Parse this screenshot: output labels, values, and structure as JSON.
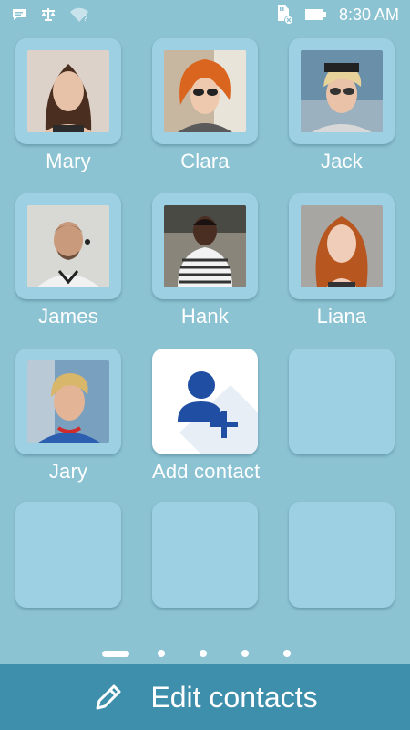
{
  "status_bar": {
    "time": "8:30 AM",
    "icons": [
      "chat-icon",
      "scale-icon",
      "wifi-question-icon",
      "sd-card-icon",
      "battery-icon"
    ]
  },
  "contacts": [
    {
      "name": "Mary",
      "avatar": "avatar-photo",
      "colors": {
        "bg": "#d9cfc6",
        "hair": "#4a2e1f",
        "skin": "#e8c2a8"
      }
    },
    {
      "name": "Clara",
      "avatar": "avatar-photo",
      "colors": {
        "bg": "#c8b7a0",
        "hair": "#d9651f",
        "skin": "#efc9ae"
      }
    },
    {
      "name": "Jack",
      "avatar": "avatar-photo",
      "colors": {
        "bg": "#6a8fa8",
        "hair": "#e7d29a",
        "skin": "#eac2a7"
      }
    },
    {
      "name": "James",
      "avatar": "avatar-photo",
      "colors": {
        "bg": "#d8d8d4",
        "hair": "#6b4f3c",
        "skin": "#c99a7c"
      }
    },
    {
      "name": "Hank",
      "avatar": "avatar-photo",
      "colors": {
        "bg": "#8a857a",
        "hair": "#1a1210",
        "skin": "#4a2e22"
      }
    },
    {
      "name": "Liana",
      "avatar": "avatar-photo",
      "colors": {
        "bg": "#a7a6a3",
        "hair": "#b8561f",
        "skin": "#f0cdb9"
      }
    },
    {
      "name": "Jary",
      "avatar": "avatar-photo",
      "colors": {
        "bg": "#7aa0c0",
        "hair": "#d8b66a",
        "skin": "#e3b596"
      }
    }
  ],
  "add_contact": {
    "label": "Add contact",
    "icon": "add-person-icon",
    "accent": "#1f4ea3"
  },
  "empty_slots": 4,
  "pager": {
    "pages": 5,
    "current": 1
  },
  "bottom_bar": {
    "label": "Edit contacts",
    "icon": "pencil-icon"
  },
  "colors": {
    "background": "#8cc3d3",
    "tile": "#9dd0e2",
    "bottom_bar": "#3d8fab"
  }
}
